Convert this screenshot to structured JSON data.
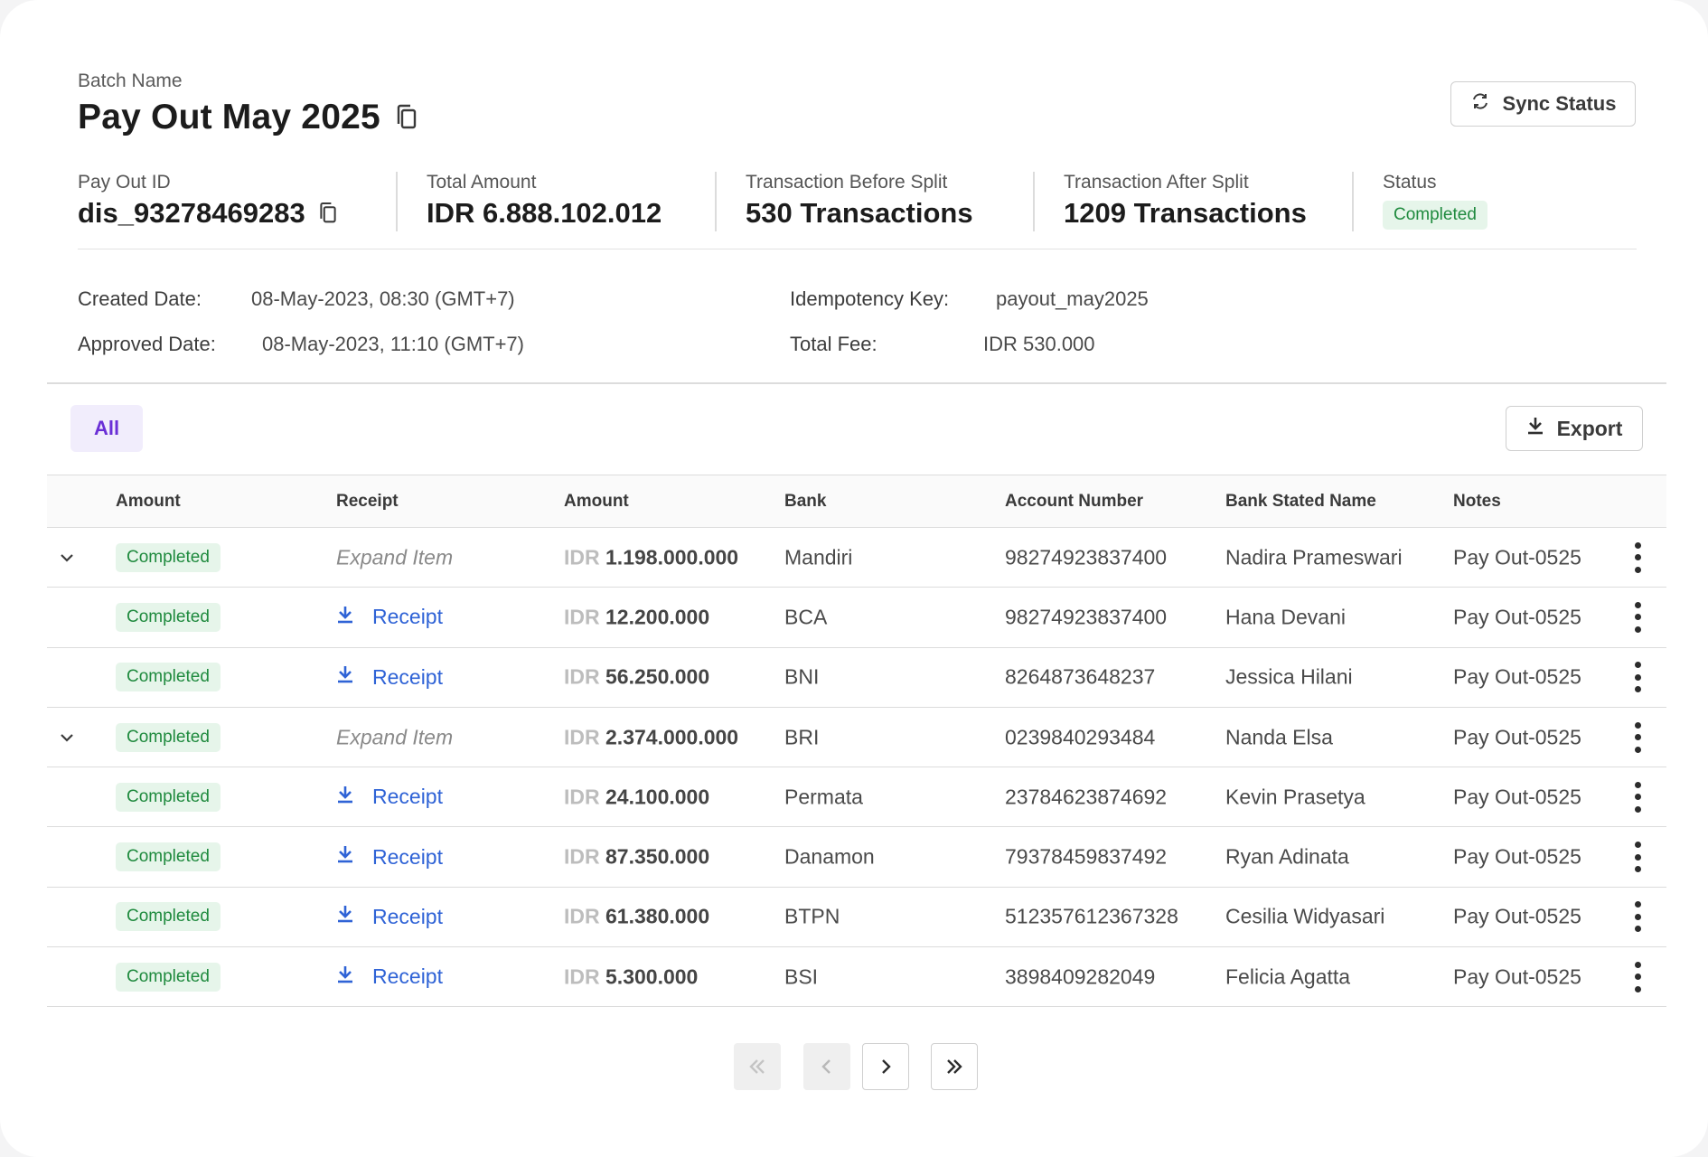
{
  "header": {
    "batch_label": "Batch Name",
    "batch_name": "Pay Out May 2025",
    "sync_button": "Sync Status"
  },
  "stats": [
    {
      "label": "Pay Out ID",
      "value": "dis_93278469283"
    },
    {
      "label": "Total Amount",
      "value": "IDR 6.888.102.012"
    },
    {
      "label": "Transaction Before Split",
      "value": "530 Transactions"
    },
    {
      "label": "Transaction After Split",
      "value": "1209 Transactions"
    },
    {
      "label": "Status",
      "value": "Completed"
    }
  ],
  "details": {
    "created_label": "Created Date:",
    "created_value": "08-May-2023, 08:30 (GMT+7)",
    "approved_label": "Approved Date:",
    "approved_value": "08-May-2023, 11:10 (GMT+7)",
    "idempotency_label": "Idempotency Key:",
    "idempotency_value": "payout_may2025",
    "fee_label": "Total Fee:",
    "fee_value": "IDR 530.000"
  },
  "filters": {
    "tab_all": "All",
    "export_button": "Export"
  },
  "table": {
    "columns": [
      "Amount",
      "Receipt",
      "Amount",
      "Bank",
      "Account Number",
      "Bank Stated Name",
      "Notes"
    ],
    "rows": [
      {
        "expandable": true,
        "status": "Completed",
        "receipt": "Expand Item",
        "currency": "IDR",
        "amount": "1.198.000.000",
        "bank": "Mandiri",
        "account": "98274923837400",
        "name": "Nadira Prameswari",
        "notes": "Pay Out-0525"
      },
      {
        "expandable": false,
        "status": "Completed",
        "receipt": "Receipt",
        "currency": "IDR",
        "amount": "12.200.000",
        "bank": "BCA",
        "account": "98274923837400",
        "name": "Hana Devani",
        "notes": "Pay Out-0525"
      },
      {
        "expandable": false,
        "status": "Completed",
        "receipt": "Receipt",
        "currency": "IDR",
        "amount": "56.250.000",
        "bank": "BNI",
        "account": "8264873648237",
        "name": "Jessica Hilani",
        "notes": "Pay Out-0525"
      },
      {
        "expandable": true,
        "status": "Completed",
        "receipt": "Expand Item",
        "currency": "IDR",
        "amount": "2.374.000.000",
        "bank": "BRI",
        "account": "0239840293484",
        "name": "Nanda Elsa",
        "notes": "Pay Out-0525"
      },
      {
        "expandable": false,
        "status": "Completed",
        "receipt": "Receipt",
        "currency": "IDR",
        "amount": "24.100.000",
        "bank": "Permata",
        "account": "23784623874692",
        "name": "Kevin Prasetya",
        "notes": "Pay Out-0525"
      },
      {
        "expandable": false,
        "status": "Completed",
        "receipt": "Receipt",
        "currency": "IDR",
        "amount": "87.350.000",
        "bank": "Danamon",
        "account": "79378459837492",
        "name": "Ryan Adinata",
        "notes": "Pay Out-0525"
      },
      {
        "expandable": false,
        "status": "Completed",
        "receipt": "Receipt",
        "currency": "IDR",
        "amount": "61.380.000",
        "bank": "BTPN",
        "account": "512357612367328",
        "name": "Cesilia Widyasari",
        "notes": "Pay Out-0525"
      },
      {
        "expandable": false,
        "status": "Completed",
        "receipt": "Receipt",
        "currency": "IDR",
        "amount": "5.300.000",
        "bank": "BSI",
        "account": "3898409282049",
        "name": "Felicia Agatta",
        "notes": "Pay Out-0525"
      }
    ]
  },
  "pagination": {
    "first_icon": "double-chevron-left-icon",
    "prev_icon": "chevron-left-icon",
    "next_icon": "chevron-right-icon",
    "last_icon": "double-chevron-right-icon"
  },
  "colors": {
    "accent_purple": "#6a2fd6",
    "link_blue": "#2f63d6",
    "success_green": "#1f8a3e",
    "success_bg": "#e6f5ea"
  }
}
